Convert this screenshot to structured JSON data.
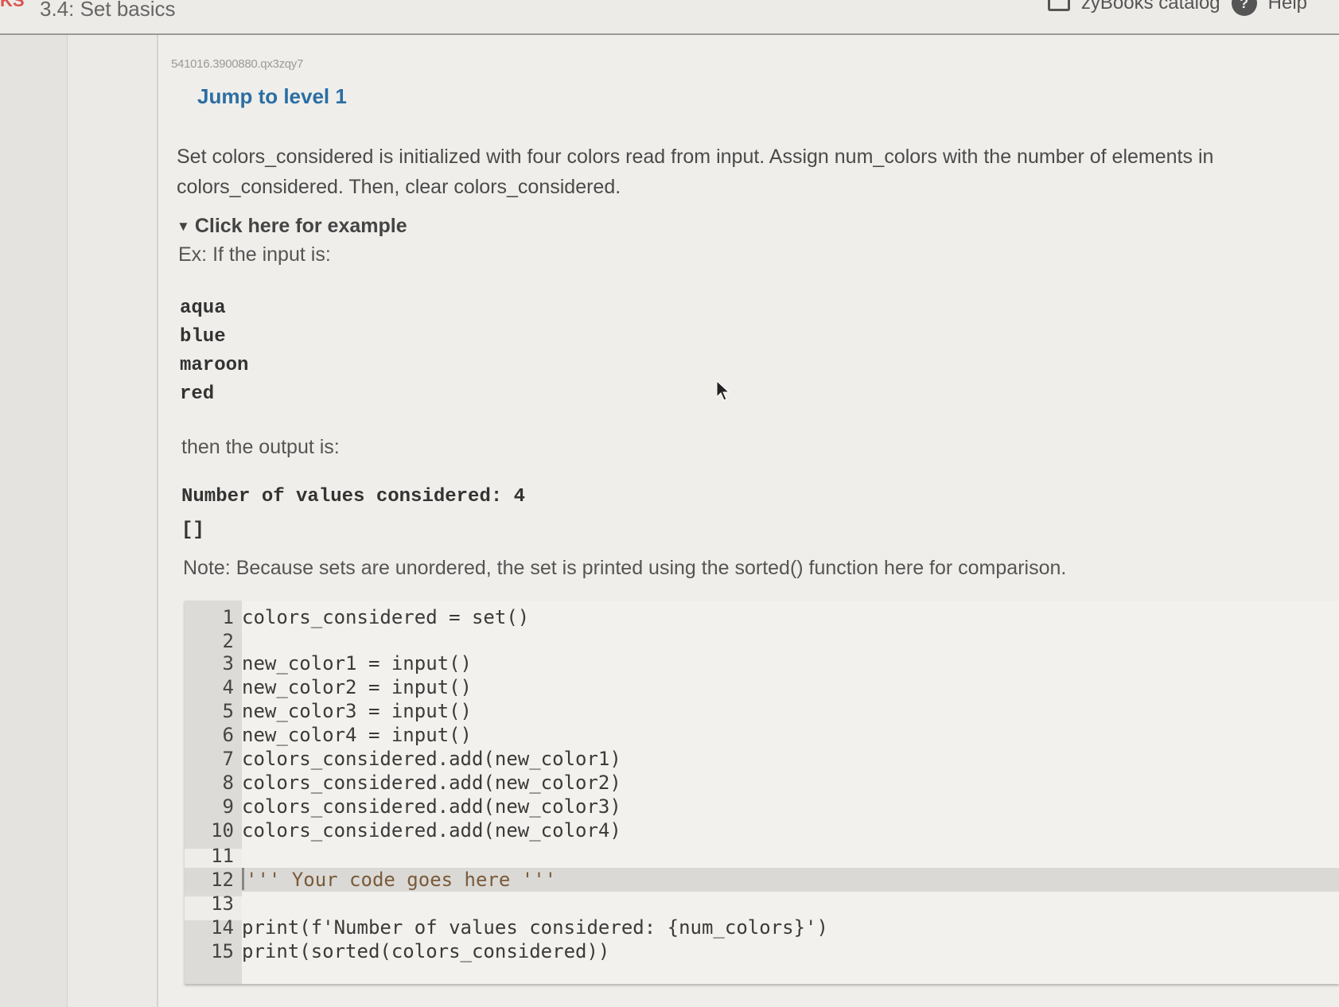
{
  "header": {
    "brand_fragment": "KS",
    "section_title": "3.4: Set basics",
    "catalog_label": "zyBooks catalog",
    "help_label": "Help"
  },
  "activity": {
    "id": "541016.3900880.qx3zqy7",
    "jump_link": "Jump to level 1",
    "prompt": "Set colors_considered is initialized with four colors read from input. Assign num_colors with the number of elements in colors_considered. Then, clear colors_considered.",
    "example_toggle": "Click here for example",
    "example_intro": "Ex: If the input is:",
    "example_input": [
      "aqua",
      "blue",
      "maroon",
      "red"
    ],
    "output_intro": "then the output is:",
    "example_output": [
      "Number of values considered: 4",
      "[]"
    ],
    "note": "Note: Because sets are unordered, the set is printed using the sorted() function here for comparison."
  },
  "editor": {
    "lines": [
      {
        "n": "1",
        "code": "colors_considered = set()"
      },
      {
        "n": "2",
        "code": ""
      },
      {
        "n": "3",
        "code": "new_color1 = input()"
      },
      {
        "n": "4",
        "code": "new_color2 = input()"
      },
      {
        "n": "5",
        "code": "new_color3 = input()"
      },
      {
        "n": "6",
        "code": "new_color4 = input()"
      },
      {
        "n": "7",
        "code": "colors_considered.add(new_color1)"
      },
      {
        "n": "8",
        "code": "colors_considered.add(new_color2)"
      },
      {
        "n": "9",
        "code": "colors_considered.add(new_color3)"
      },
      {
        "n": "10",
        "code": "colors_considered.add(new_color4)"
      },
      {
        "n": "11",
        "code": ""
      },
      {
        "n": "12",
        "code": "''' Your code goes here '''"
      },
      {
        "n": "13",
        "code": ""
      },
      {
        "n": "14",
        "code": "print(f'Number of values considered: {num_colors}')"
      },
      {
        "n": "15",
        "code": "print(sorted(colors_considered))"
      }
    ],
    "active_line": 12
  },
  "colors": {
    "link": "#2b6ea3",
    "brand": "#d9534f"
  }
}
